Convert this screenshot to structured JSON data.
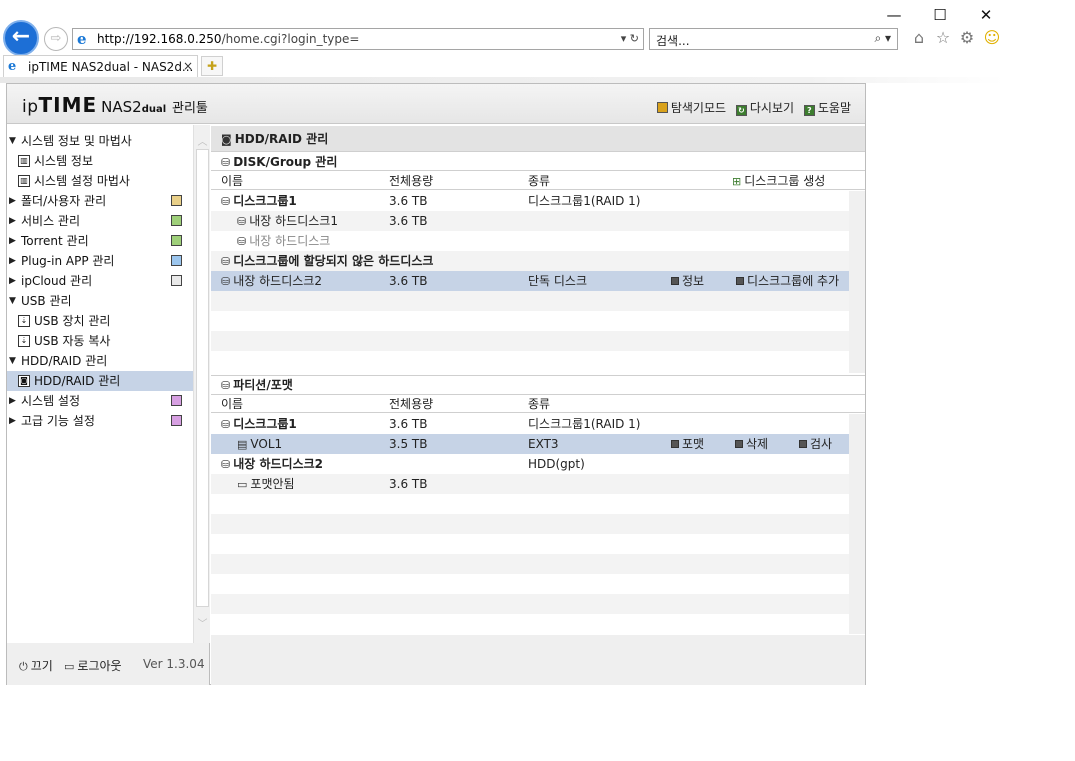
{
  "browser": {
    "url_prefix": "http://192.168.0.250",
    "url_rest": "/home.cgi?login_type=",
    "search_placeholder": "검색...",
    "tab_title": "ipTIME NAS2dual - NAS2d...",
    "back_glyph": "←",
    "forward_glyph": "⇨",
    "addr_controls": "▾ ↻",
    "search_controls": "⌕ ▾",
    "tab_close": "×",
    "window_controls": [
      "—",
      "☐",
      "✕"
    ],
    "toolbar_icons": [
      "home-icon",
      "star-icon",
      "gear-icon",
      "smiley-icon"
    ]
  },
  "header": {
    "logo_ip": "ip",
    "logo_time": "TIME",
    "logo_model": "NAS2",
    "logo_dual": "dual",
    "logo_suffix": "관리툴",
    "links": {
      "search_mode": "탐색기모드",
      "reload": "다시보기",
      "help": "도움말"
    }
  },
  "sidebar": {
    "items": [
      {
        "label": "시스템 정보 및 마법사",
        "type": "group",
        "open": true
      },
      {
        "label": "시스템 정보",
        "type": "sub",
        "icon": "bar-chart-icon"
      },
      {
        "label": "시스템 설정 마법사",
        "type": "sub",
        "icon": "bar-chart-icon"
      },
      {
        "label": "폴더/사용자 관리",
        "type": "group",
        "open": false,
        "icon": "folder-user-icon",
        "color": "y"
      },
      {
        "label": "서비스 관리",
        "type": "group",
        "open": false,
        "icon": "service-icon",
        "color": "g"
      },
      {
        "label": "Torrent 관리",
        "type": "group",
        "open": false,
        "icon": "torrent-icon",
        "color": "g"
      },
      {
        "label": "Plug-in APP 관리",
        "type": "group",
        "open": false,
        "icon": "plugin-icon",
        "color": "b"
      },
      {
        "label": "ipCloud 관리",
        "type": "group",
        "open": false,
        "icon": "cloud-icon",
        "color": "w"
      },
      {
        "label": "USB 관리",
        "type": "group",
        "open": true
      },
      {
        "label": "USB 장치 관리",
        "type": "sub",
        "icon": "usb-icon"
      },
      {
        "label": "USB 자동 복사",
        "type": "sub",
        "icon": "usb-icon"
      },
      {
        "label": "HDD/RAID 관리",
        "type": "group",
        "open": true
      },
      {
        "label": "HDD/RAID 관리",
        "type": "sub",
        "icon": "disk-icon",
        "selected": true
      },
      {
        "label": "시스템 설정",
        "type": "group",
        "open": false,
        "icon": "system-icon",
        "color": "p"
      },
      {
        "label": "고급 기능 설정",
        "type": "group",
        "open": false,
        "icon": "advanced-icon",
        "color": "p"
      }
    ],
    "footer": {
      "power": "끄기",
      "logout": "로그아웃",
      "version": "Ver 1.3.04"
    }
  },
  "main": {
    "title": "HDD/RAID 관리",
    "disk_section": {
      "title": "DISK/Group 관리",
      "columns": [
        "이름",
        "전체용량",
        "종류"
      ],
      "create_group": "디스크그룹 생성",
      "rows": [
        {
          "name": "디스크그룹1",
          "capacity": "3.6 TB",
          "type": "디스크그룹1(RAID 1)",
          "style": "group"
        },
        {
          "name": "내장 하드디스크1",
          "capacity": "3.6 TB",
          "type": "",
          "style": "member"
        },
        {
          "name": "내장 하드디스크",
          "capacity": "",
          "type": "",
          "style": "member-empty"
        },
        {
          "name": "디스크그룹에 할당되지 않은 하드디스크",
          "capacity": "",
          "type": "",
          "style": "group"
        },
        {
          "name": "내장 하드디스크2",
          "capacity": "3.6 TB",
          "type": "단독 디스크",
          "style": "disk",
          "info": "정보",
          "add": "디스크그룹에 추가"
        }
      ]
    },
    "partition_section": {
      "title": "파티션/포맷",
      "columns": [
        "이름",
        "전체용량",
        "종류"
      ],
      "rows": [
        {
          "name": "디스크그룹1",
          "capacity": "3.6 TB",
          "type": "디스크그룹1(RAID 1)",
          "style": "group"
        },
        {
          "name": "VOL1",
          "capacity": "3.5 TB",
          "type": "EXT3",
          "style": "volume",
          "format": "포맷",
          "delete": "삭제",
          "check": "검사"
        },
        {
          "name": "내장 하드디스크2",
          "capacity": "",
          "type": "HDD(gpt)",
          "style": "group"
        },
        {
          "name": "포맷안됨",
          "capacity": "3.6 TB",
          "type": "",
          "style": "unformatted"
        }
      ]
    }
  },
  "colors": {
    "selected_row": "#c6d3e6",
    "header_bg": "#e3e3e3",
    "alt_row": "#f3f3f3",
    "browser_accent": "#1d6fd6"
  }
}
